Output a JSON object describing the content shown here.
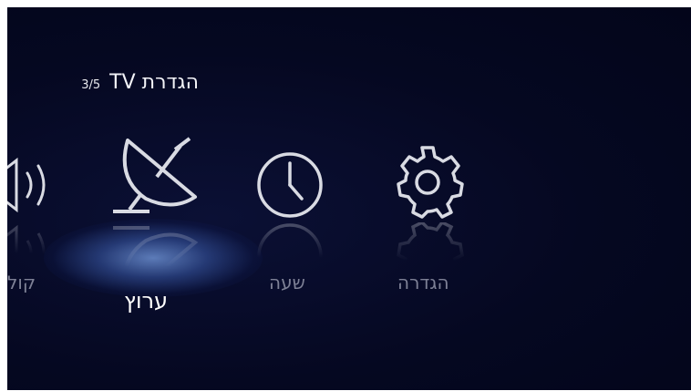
{
  "header": {
    "title": "הגדרת TV",
    "step": "3/5"
  },
  "menu": {
    "items": [
      {
        "label": "קול",
        "icon": "speaker-icon"
      },
      {
        "label": "ערוץ",
        "icon": "satellite-dish-icon",
        "selected": true
      },
      {
        "label": "שעה",
        "icon": "clock-icon"
      },
      {
        "label": "הגדרה",
        "icon": "gear-icon"
      }
    ]
  },
  "colors": {
    "background": "#050821",
    "selected_label": "#ffffff",
    "label": "#7e8196",
    "icon": "#d9dbe3",
    "glow": "#6e9ae0"
  }
}
